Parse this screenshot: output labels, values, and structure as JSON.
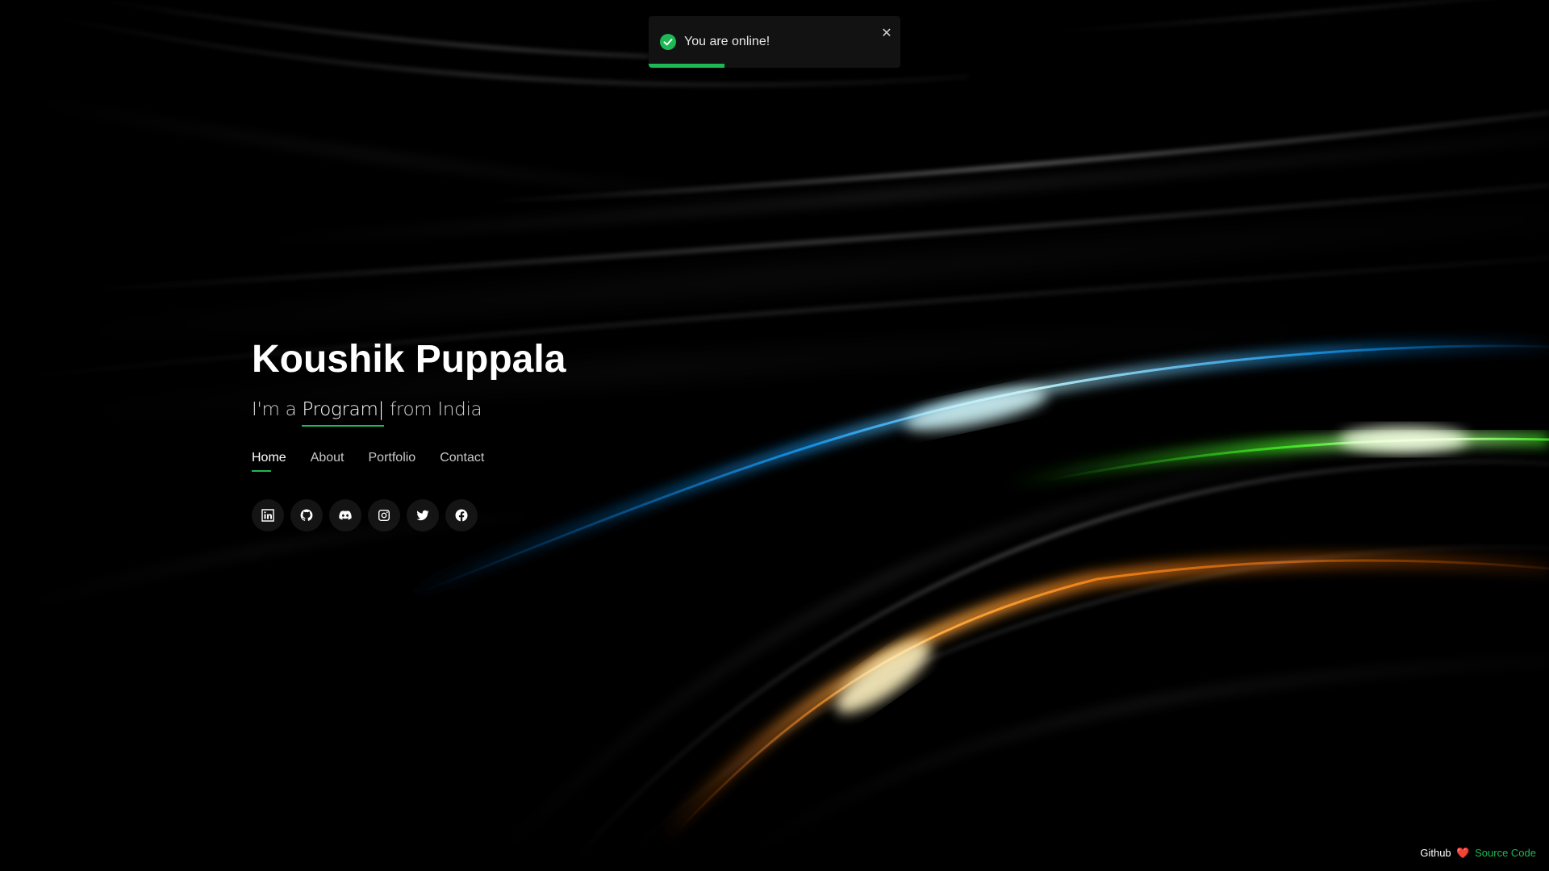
{
  "toast": {
    "message": "You are online!",
    "close_glyph": "✕",
    "progress": 0.3,
    "icon": "check-circle-icon",
    "accent": "#1db954"
  },
  "hero": {
    "name": "Koushik Puppala",
    "tagline_prefix": "I'm a",
    "tagline_typed": "Program",
    "tagline_cursor": "|",
    "tagline_suffix": "from India"
  },
  "nav": {
    "items": [
      {
        "label": "Home",
        "active": true
      },
      {
        "label": "About",
        "active": false
      },
      {
        "label": "Portfolio",
        "active": false
      },
      {
        "label": "Contact",
        "active": false
      }
    ]
  },
  "social": {
    "icons": [
      "linkedin-icon",
      "github-icon",
      "discord-icon",
      "instagram-icon",
      "twitter-icon",
      "facebook-icon"
    ]
  },
  "footer": {
    "prefix": "Github",
    "heart": "❤️",
    "link": "Source Code"
  },
  "colors": {
    "accent_green": "#1db954",
    "background": "#000000",
    "streak_blue": "#1aa3ff",
    "streak_green": "#4bff2a",
    "streak_orange": "#ff8a1a"
  }
}
